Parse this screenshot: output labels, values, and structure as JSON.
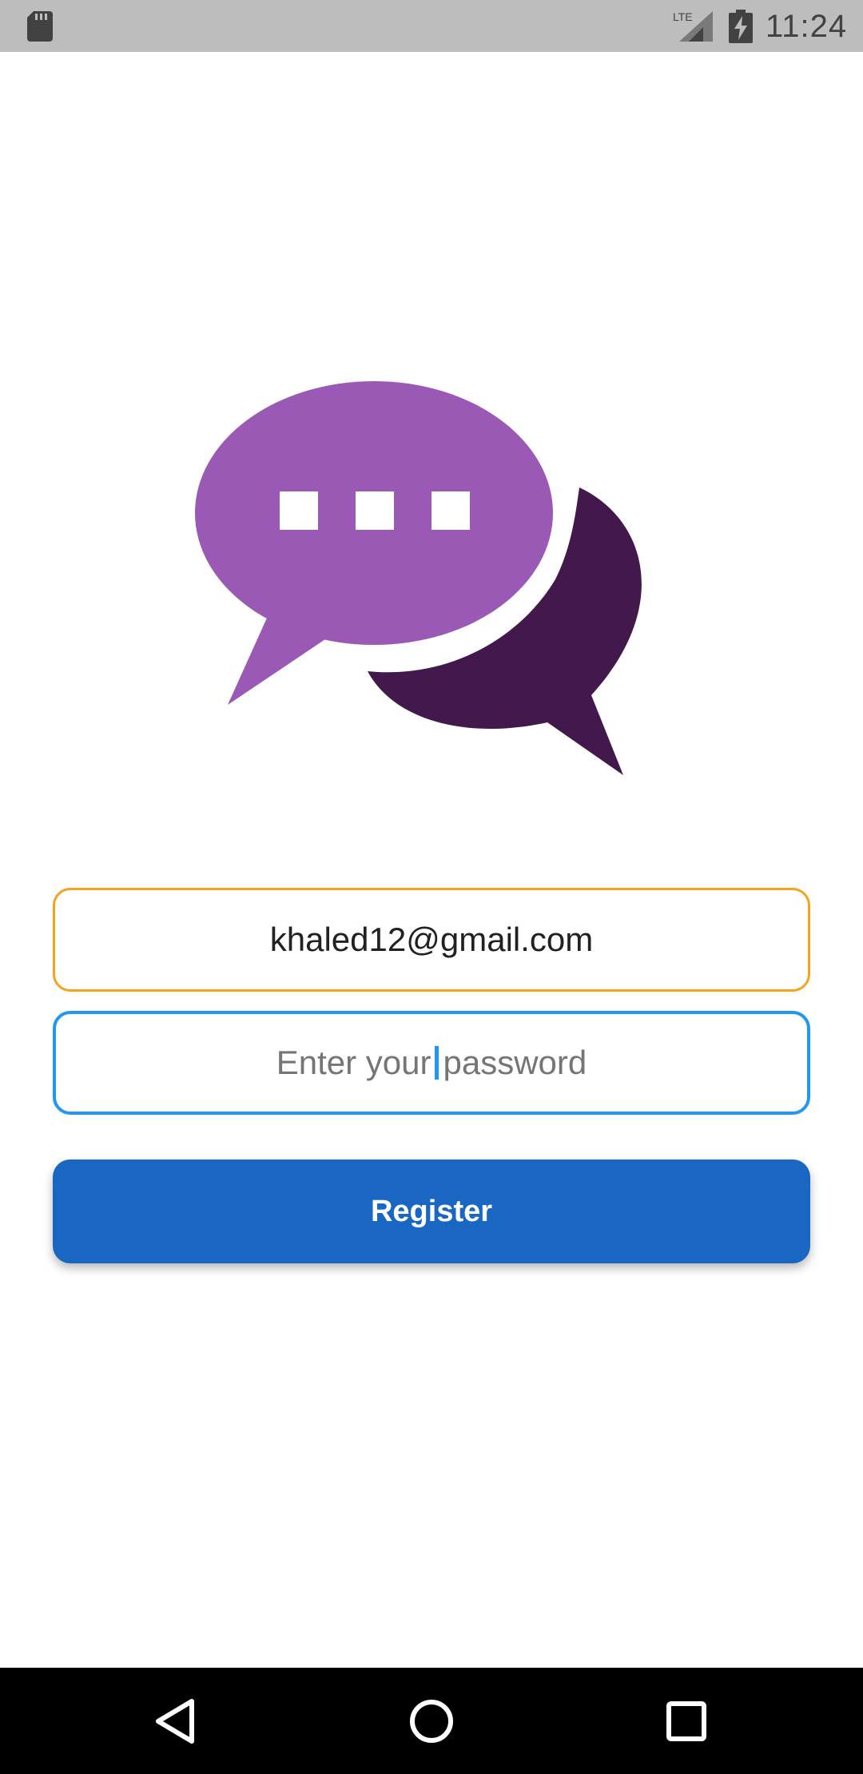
{
  "status_bar": {
    "time": "11:24",
    "network_label": "LTE",
    "icons": [
      "sd-card-icon",
      "lte-signal-icon",
      "battery-charging-icon"
    ]
  },
  "logo": {
    "icon": "chat-bubbles-icon",
    "colors": {
      "front_bubble": "#9b59b6",
      "back_bubble": "#43184d"
    }
  },
  "form": {
    "email": {
      "value": "khaled12@gmail.com",
      "border_color": "#f5a31a"
    },
    "password": {
      "placeholder_before_caret": "Enter your",
      "placeholder_after_caret": "password",
      "border_color": "#2196f3"
    },
    "register_button": {
      "label": "Register",
      "color": "#1967c3"
    }
  },
  "nav_bar": {
    "icons": [
      "back-icon",
      "home-icon",
      "recents-icon"
    ]
  }
}
